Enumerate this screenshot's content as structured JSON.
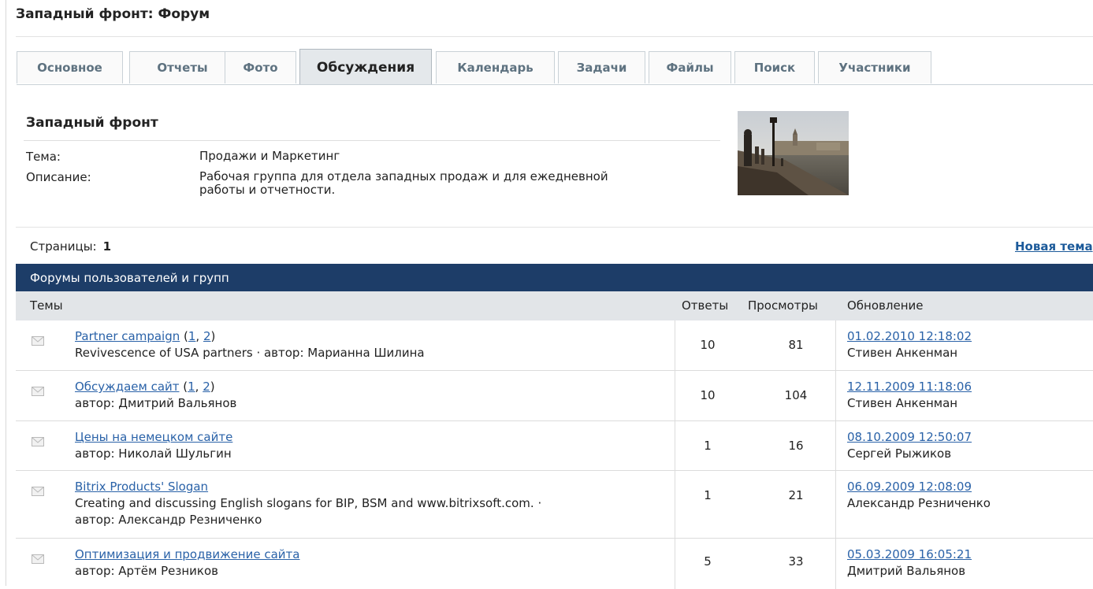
{
  "page_title": "Западный фронт: Форум",
  "tabs": [
    {
      "label": "Основное"
    },
    {
      "label": "Отчеты"
    },
    {
      "label": "Фото"
    },
    {
      "label": "Обсуждения"
    },
    {
      "label": "Календарь"
    },
    {
      "label": "Задачи"
    },
    {
      "label": "Файлы"
    },
    {
      "label": "Поиск"
    },
    {
      "label": "Участники"
    }
  ],
  "active_tab": "Обсуждения",
  "group": {
    "name": "Западный фронт",
    "topic_label": "Тема:",
    "topic_value": "Продажи и Маркетинг",
    "description_label": "Описание:",
    "description_line1": "Рабочая группа для отдела западных продаж и для ежедневной",
    "description_line2": "работы и отчетности."
  },
  "pagination": {
    "label": "Страницы:",
    "current": "1"
  },
  "new_topic_label": "Новая тема",
  "forum_header": "Форумы пользователей и групп",
  "columns": {
    "topics": "Темы",
    "replies": "Ответы",
    "views": "Просмотры",
    "updated": "Обновление"
  },
  "topics": [
    {
      "title": "Partner campaign",
      "pages": [
        "1",
        "2"
      ],
      "desc_line1": "Revivescence of USA partners · автор: Марианна Шилина",
      "desc_line2": "",
      "replies": "10",
      "views": "81",
      "updated": "01.02.2010 12:18:02",
      "updated_by": "Стивен Анкенман"
    },
    {
      "title": "Обсуждаем сайт",
      "pages": [
        "1",
        "2"
      ],
      "desc_line1": "автор: Дмитрий Вальянов",
      "desc_line2": "",
      "replies": "10",
      "views": "104",
      "updated": "12.11.2009 11:18:06",
      "updated_by": "Стивен Анкенман"
    },
    {
      "title": "Цены на немецком сайте",
      "pages": [],
      "desc_line1": "автор: Николай Шульгин",
      "desc_line2": "",
      "replies": "1",
      "views": "16",
      "updated": "08.10.2009 12:50:07",
      "updated_by": "Сергей Рыжиков"
    },
    {
      "title": "Bitrix Products' Slogan",
      "pages": [],
      "desc_line1": "Creating and discussing English slogans for BIP, BSM and www.bitrixsoft.com. ·",
      "desc_line2": "автор: Александр Резниченко",
      "replies": "1",
      "views": "21",
      "updated": "06.09.2009 12:08:09",
      "updated_by": "Александр Резниченко"
    },
    {
      "title": "Оптимизация и продвижение сайта",
      "pages": [],
      "desc_line1": "автор: Артём Резников",
      "desc_line2": "",
      "replies": "5",
      "views": "33",
      "updated": "05.03.2009 16:05:21",
      "updated_by": "Дмитрий Вальянов"
    }
  ],
  "colors": {
    "header_bg": "#1d3d68",
    "link": "#2a62a8",
    "tab_text": "#5e7280",
    "active_tab_bg": "#e4e8eb",
    "cols_header_bg": "#e2e5e8"
  }
}
